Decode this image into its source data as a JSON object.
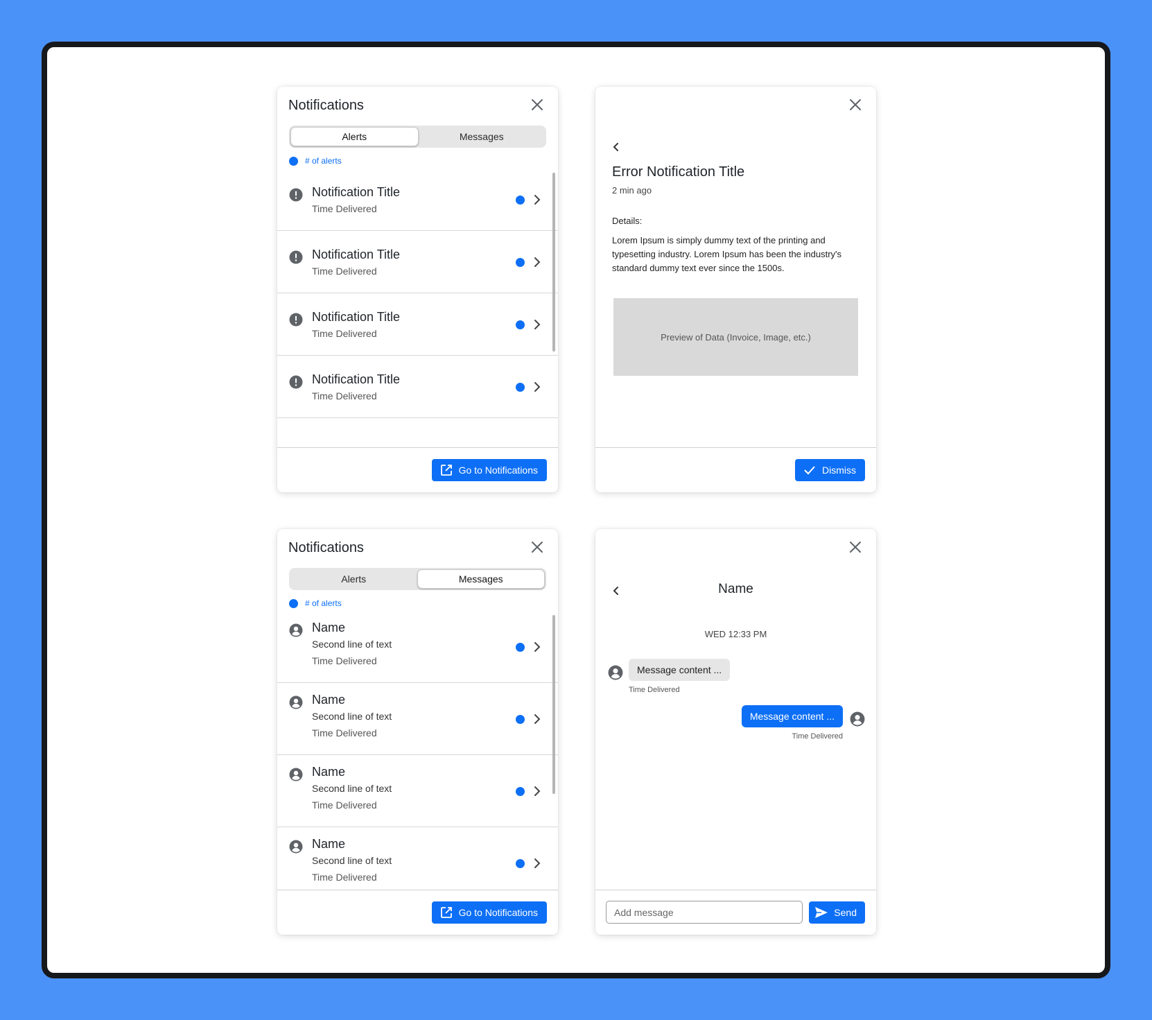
{
  "alerts_panel": {
    "title": "Notifications",
    "tabs": [
      {
        "label": "Alerts",
        "active": true
      },
      {
        "label": "Messages",
        "active": false
      }
    ],
    "count_label": "# of alerts",
    "items": [
      {
        "title": "Notification Title",
        "time": "Time Delivered",
        "icon": "alert-icon",
        "unread": true
      },
      {
        "title": "Notification Title",
        "time": "Time Delivered",
        "icon": "alert-icon",
        "unread": true
      },
      {
        "title": "Notification Title",
        "time": "Time Delivered",
        "icon": "alert-icon",
        "unread": true
      },
      {
        "title": "Notification Title",
        "time": "Time Delivered",
        "icon": "alert-icon",
        "unread": true
      }
    ],
    "footer_button": "Go to Notifications"
  },
  "detail_panel": {
    "title": "Error Notification Title",
    "time": "2 min ago",
    "details_label": "Details:",
    "body": "Lorem Ipsum is simply dummy text of the printing and typesetting industry. Lorem Ipsum has been the industry's standard dummy text ever since the 1500s.",
    "preview": "Preview of Data (Invoice, Image, etc.)",
    "dismiss_button": "Dismiss"
  },
  "messages_panel": {
    "title": "Notifications",
    "tabs": [
      {
        "label": "Alerts",
        "active": false
      },
      {
        "label": "Messages",
        "active": true
      }
    ],
    "count_label": "# of alerts",
    "items": [
      {
        "name": "Name",
        "line2": "Second line of text",
        "time": "Time Delivered",
        "icon": "user-avatar-icon",
        "unread": true
      },
      {
        "name": "Name",
        "line2": "Second line of text",
        "time": "Time Delivered",
        "icon": "user-avatar-icon",
        "unread": true
      },
      {
        "name": "Name",
        "line2": "Second line of text",
        "time": "Time Delivered",
        "icon": "user-avatar-icon",
        "unread": true
      },
      {
        "name": "Name",
        "line2": "Second line of text",
        "time": "Time Delivered",
        "icon": "user-avatar-icon",
        "unread": true
      }
    ],
    "footer_button": "Go to Notifications"
  },
  "chat_panel": {
    "name": "Name",
    "date": "WED 12:33 PM",
    "incoming": {
      "text": "Message content ...",
      "time": "Time Delivered"
    },
    "outgoing": {
      "text": "Message content ...",
      "time": "Time Delivered"
    },
    "input_placeholder": "Add message",
    "send_button": "Send"
  },
  "colors": {
    "background": "#4a92f7",
    "accent": "#0d6ff5",
    "icon": "#5f6368"
  }
}
